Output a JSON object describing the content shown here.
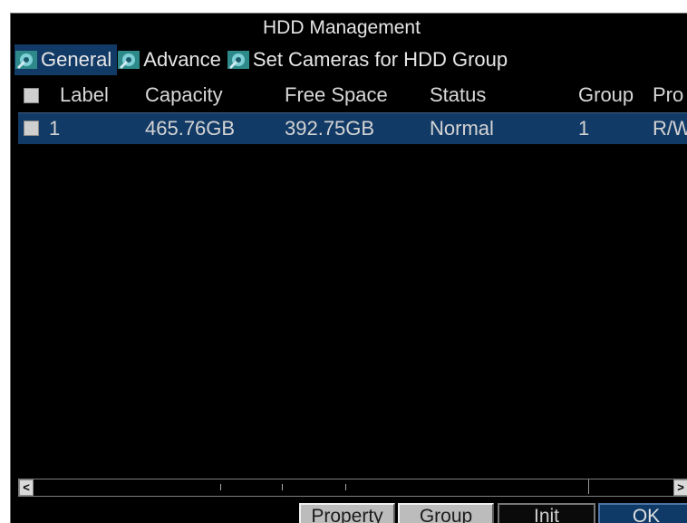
{
  "window": {
    "title": "HDD Management"
  },
  "tabs": [
    {
      "label": "General",
      "icon": "hdd-settings-icon",
      "active": true
    },
    {
      "label": "Advance",
      "icon": "hdd-settings-icon",
      "active": false
    },
    {
      "label": "Set Cameras for HDD Group",
      "icon": "hdd-settings-icon",
      "active": false
    }
  ],
  "table": {
    "headers": [
      "Label",
      "Capacity",
      "Free Space",
      "Status",
      "Group",
      "Pro"
    ],
    "rows": [
      {
        "label": "1",
        "capacity": "465.76GB",
        "free_space": "392.75GB",
        "status": "Normal",
        "group": "1",
        "property": "R/W"
      }
    ]
  },
  "scrollbar": {
    "left_arrow": "<",
    "right_arrow": ">"
  },
  "buttons": {
    "property": "Property",
    "group": "Group",
    "init": "Init",
    "ok": "OK"
  },
  "colors": {
    "background": "#000000",
    "selected_row": "#123a66",
    "text": "#d4d4d4"
  }
}
